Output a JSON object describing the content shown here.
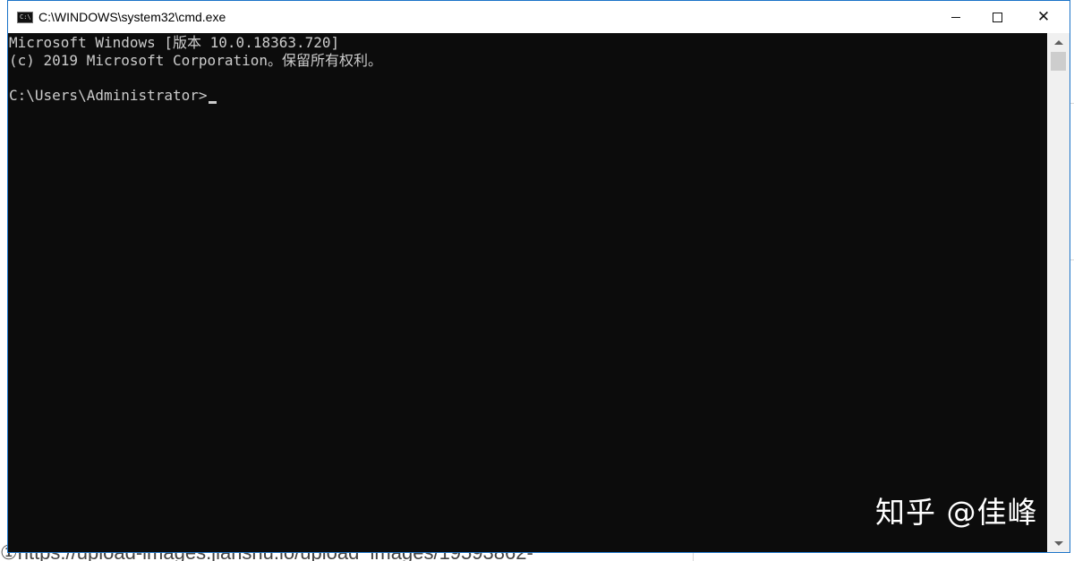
{
  "window": {
    "title": "C:\\WINDOWS\\system32\\cmd.exe",
    "controls": {
      "minimize_icon": "minimize-icon",
      "maximize_icon": "maximize-icon",
      "close_icon": "close-icon"
    }
  },
  "console": {
    "lines": [
      "Microsoft Windows [版本 10.0.18363.720]",
      "(c) 2019 Microsoft Corporation。保留所有权利。",
      "",
      "C:\\Users\\Administrator>"
    ],
    "text_color": "#cccccc",
    "background": "#0c0c0c"
  },
  "background_page": {
    "url_fragment": "①https://upload-images.jianshu.io/upload_images/19593862-"
  },
  "watermark": {
    "text": "知乎 @佳峰"
  }
}
